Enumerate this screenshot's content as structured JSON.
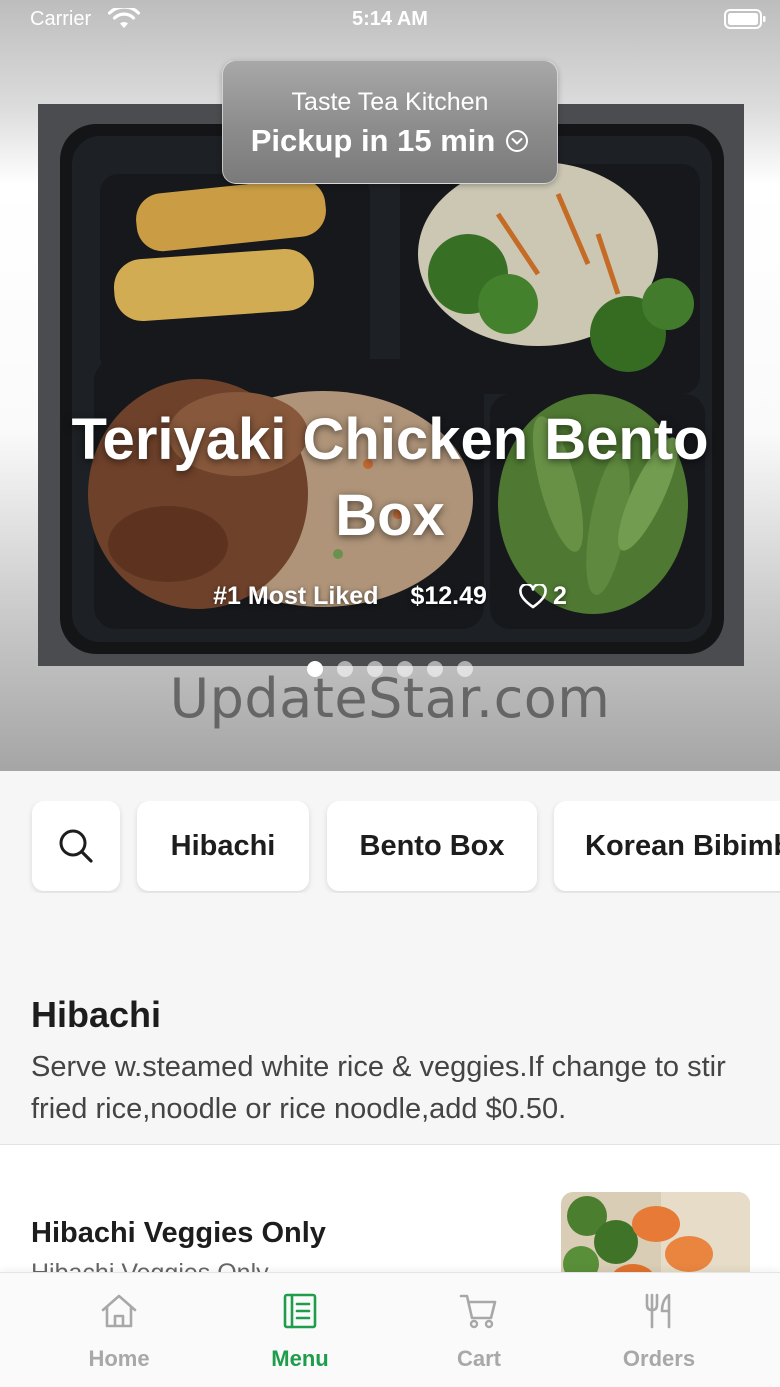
{
  "status_bar": {
    "carrier": "Carrier",
    "time": "5:14 AM"
  },
  "hero": {
    "restaurant_name": "Taste Tea Kitchen",
    "pickup_label": "Pickup in 15 min",
    "featured": {
      "title": "Teriyaki Chicken Bento Box",
      "badge": "#1 Most Liked",
      "price": "$12.49",
      "likes": "2"
    },
    "carousel": {
      "count": 6,
      "active_index": 0
    },
    "watermark": "UpdateStar.com"
  },
  "categories": [
    "Hibachi",
    "Bento Box",
    "Korean Bibimb"
  ],
  "section": {
    "title": "Hibachi",
    "description": "Serve w.steamed white rice & veggies.If change to stir fried rice,noodle or rice noodle,add $0.50.",
    "items": [
      {
        "name": "Hibachi Veggies Only",
        "description": "Hibachi Veggies Only"
      }
    ]
  },
  "tabs": [
    {
      "label": "Home",
      "icon": "home-icon"
    },
    {
      "label": "Menu",
      "icon": "menu-icon"
    },
    {
      "label": "Cart",
      "icon": "cart-icon"
    },
    {
      "label": "Orders",
      "icon": "fork-knife-icon"
    }
  ],
  "colors": {
    "accent": "#1f9d4d",
    "inactive": "#a8a8a8"
  }
}
